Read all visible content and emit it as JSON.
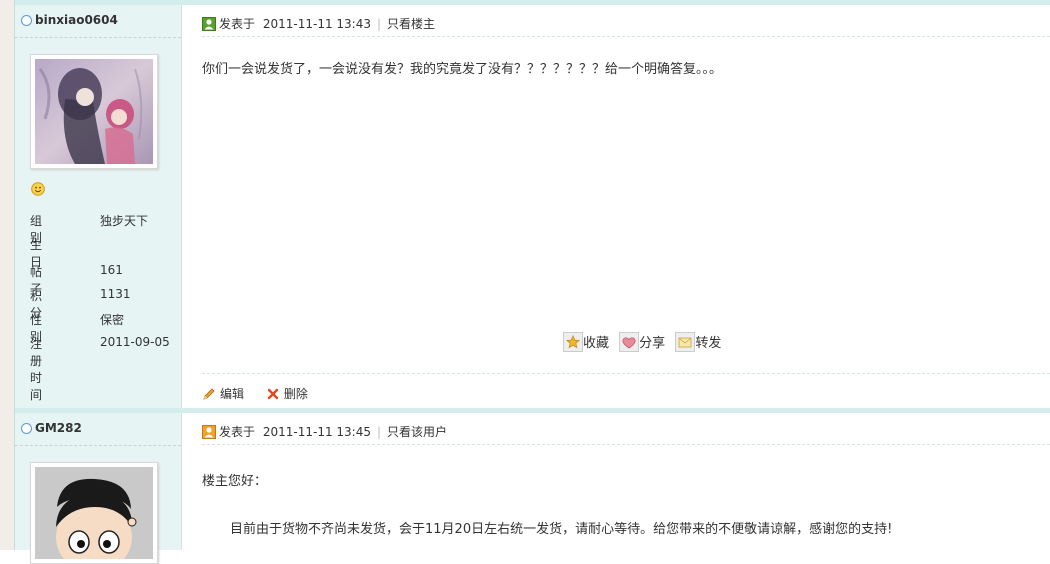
{
  "posts": [
    {
      "username": "binxiao0604",
      "icon": "user-icon",
      "posted_label": "发表于",
      "timestamp": "2011-11-11 13:43",
      "view_only_link": "只看楼主",
      "content": "你们一会说发货了，一会说没有发？我的究竟发了没有？？？？？？？给一个明确答复。。。",
      "profile": {
        "group_label": "组别",
        "group_value": "独步天下",
        "birthday_label": "生日",
        "birthday_value": "",
        "posts_label": "帖子",
        "posts_value": "161",
        "points_label": "积分",
        "points_value": "1131",
        "gender_label": "性别",
        "gender_value": "保密",
        "joined_label": "注册时间",
        "joined_value": "2011-09-05"
      },
      "share": {
        "favorite": "收藏",
        "share": "分享",
        "forward": "转发"
      },
      "actions": {
        "edit": "编辑",
        "delete": "删除"
      }
    },
    {
      "username": "GM282",
      "icon": "user-icon",
      "posted_label": "发表于",
      "timestamp": "2011-11-11 13:45",
      "view_only_link": "只看该用户",
      "greeting": "楼主您好：",
      "content": "目前由于货物不齐尚未发货，会于11月20日左右统一发货，请耐心等待。给您带来的不便敬请谅解，感谢您的支持!"
    }
  ],
  "colors": {
    "sidebar_bg": "#e6f4f4",
    "divider": "#d3ecec",
    "online": "#5b9bd5",
    "user_icon_green": "#5aa02c",
    "user_icon_orange": "#f0a030"
  }
}
